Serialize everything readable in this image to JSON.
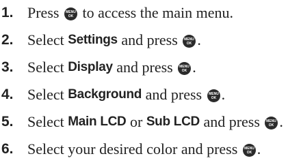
{
  "key": {
    "icon": "menu-ok-key-icon",
    "line1": "MENU",
    "line2": "OK"
  },
  "steps": [
    {
      "num": "1.",
      "a": "Press ",
      "b": " to access the main menu."
    },
    {
      "num": "2.",
      "a": "Select ",
      "bold1": "Settings",
      "b": " and press ",
      "c": "."
    },
    {
      "num": "3.",
      "a": "Select ",
      "bold1": "Display",
      "b": " and press ",
      "c": "."
    },
    {
      "num": "4.",
      "a": "Select ",
      "bold1": "Background",
      "b": " and press ",
      "c": "."
    },
    {
      "num": "5.",
      "a": "Select ",
      "bold1": "Main LCD",
      "mid": " or ",
      "bold2": "Sub LCD",
      "b": " and press ",
      "c": "."
    },
    {
      "num": "6.",
      "a": "Select your desired color and press ",
      "c": "."
    }
  ]
}
